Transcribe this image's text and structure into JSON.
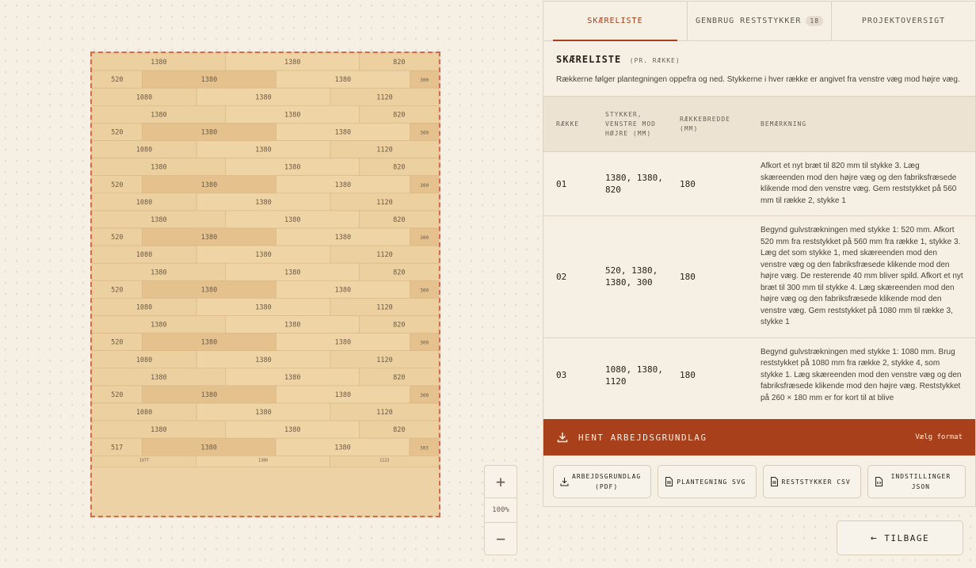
{
  "floor_plan": {
    "rows": [
      {
        "pieces": [
          1380,
          1380,
          820
        ]
      },
      {
        "pieces": [
          520,
          1380,
          1380,
          300
        ]
      },
      {
        "pieces": [
          1080,
          1380,
          1120
        ]
      },
      {
        "pieces": [
          1380,
          1380,
          820
        ]
      },
      {
        "pieces": [
          520,
          1380,
          1380,
          300
        ]
      },
      {
        "pieces": [
          1080,
          1380,
          1120
        ]
      },
      {
        "pieces": [
          1380,
          1380,
          820
        ]
      },
      {
        "pieces": [
          520,
          1380,
          1380,
          300
        ]
      },
      {
        "pieces": [
          1080,
          1380,
          1120
        ]
      },
      {
        "pieces": [
          1380,
          1380,
          820
        ]
      },
      {
        "pieces": [
          520,
          1380,
          1380,
          300
        ]
      },
      {
        "pieces": [
          1080,
          1380,
          1120
        ]
      },
      {
        "pieces": [
          1380,
          1380,
          820
        ]
      },
      {
        "pieces": [
          520,
          1380,
          1380,
          300
        ]
      },
      {
        "pieces": [
          1080,
          1380,
          1120
        ]
      },
      {
        "pieces": [
          1380,
          1380,
          820
        ]
      },
      {
        "pieces": [
          520,
          1380,
          1380,
          300
        ]
      },
      {
        "pieces": [
          1080,
          1380,
          1120
        ]
      },
      {
        "pieces": [
          1380,
          1380,
          820
        ]
      },
      {
        "pieces": [
          520,
          1380,
          1380,
          300
        ]
      },
      {
        "pieces": [
          1080,
          1380,
          1120
        ]
      },
      {
        "pieces": [
          1380,
          1380,
          820
        ]
      },
      {
        "pieces": [
          517,
          1380,
          1380,
          303
        ]
      },
      {
        "pieces": [
          1077,
          1380,
          1123
        ],
        "partial": true
      }
    ],
    "colors": {
      "light": "#efd4a5",
      "dark": "#e5c18e",
      "mid": "#ecd0a0",
      "border": "#d9694e"
    }
  },
  "zoom": {
    "plus": "+",
    "value": "100%",
    "minus": "−"
  },
  "tabs": [
    {
      "label": "SKÆRELISTE",
      "active": true
    },
    {
      "label": "GENBRUG RESTSTYKKER",
      "badge": "18"
    },
    {
      "label": "PROJEKTOVERSIGT"
    }
  ],
  "cut_list": {
    "title": "SKÆRELISTE",
    "subtitle": "(PR. RÆKKE)",
    "description": "Rækkerne følger plantegningen oppefra og ned. Stykkerne i hver række er angivet fra venstre væg mod højre væg.",
    "columns": {
      "row": "RÆKKE",
      "pieces": "STYKKER, VENSTRE MOD HØJRE (MM)",
      "width": "RÆKKEBREDDE (MM)",
      "note": "BEMÆRKNING"
    },
    "rows": [
      {
        "num": "01",
        "pieces": "1380, 1380, 820",
        "width": "180",
        "note": "Afkort et nyt bræt til 820 mm til stykke 3. Læg skæreenden mod den højre væg og den fabriksfræsede klikende mod den venstre væg. Gem reststykket på 560 mm til række 2, stykke 1"
      },
      {
        "num": "02",
        "pieces": "520, 1380, 1380, 300",
        "width": "180",
        "note": "Begynd gulvstrækningen med stykke 1: 520 mm. Afkort 520 mm fra reststykket på 560 mm fra række 1, stykke 3. Læg det som stykke 1, med skæreenden mod den venstre væg og den fabriksfræsede klikende mod den højre væg. De resterende 40 mm bliver spild. Afkort et nyt bræt til 300 mm til stykke 4. Læg skæreenden mod den højre væg og den fabriksfræsede klikende mod den venstre væg. Gem reststykket på 1080 mm til række 3, stykke 1"
      },
      {
        "num": "03",
        "pieces": "1080, 1380, 1120",
        "width": "180",
        "note": "Begynd gulvstrækningen med stykke 1: 1080 mm. Brug reststykket på 1080 mm fra række 2, stykke 4, som stykke 1. Læg skæreenden mod den venstre væg og den fabriksfræsede klikende mod den højre væg. Reststykket på 260 × 180 mm er for kort til at blive"
      }
    ]
  },
  "download": {
    "title": "HENT ARBEJDSGRUNDLAG",
    "format_label": "Vælg format",
    "color": "#a8401b",
    "buttons": [
      {
        "label": "ARBEJDSGRUNDLAG (PDF)",
        "icon": "download-icon"
      },
      {
        "label": "PLANTEGNING SVG",
        "icon": "file-icon"
      },
      {
        "label": "RESTSTYKKER CSV",
        "icon": "file-icon"
      },
      {
        "label": "INDSTILLINGER JSON",
        "icon": "file-code-icon"
      }
    ]
  },
  "back_button": {
    "label": "TILBAGE"
  }
}
